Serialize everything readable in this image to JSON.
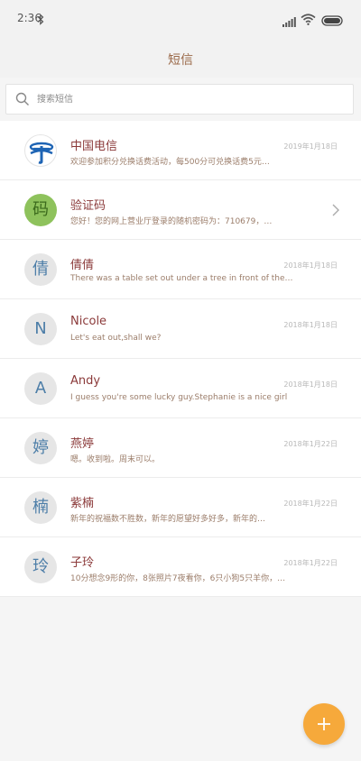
{
  "status_bar": {
    "time": "2:36",
    "icons": [
      "bluetooth-icon",
      "signal-icon",
      "wifi-icon",
      "battery-icon"
    ]
  },
  "header": {
    "title": "短信"
  },
  "search": {
    "placeholder": "搜索短信"
  },
  "conversations": [
    {
      "avatar_icon": "china-telecom-logo-icon",
      "avatar_text": "",
      "sender": "中国电信",
      "date": "2019年1月18日",
      "preview": "欢迎参加积分兑换话费活动，每500分可兑换话费5元…"
    },
    {
      "avatar_icon": "",
      "avatar_text": "码",
      "sender": "验证码",
      "date": "",
      "preview": "您好！您的网上营业厅登录的随机密码为：710679，…"
    },
    {
      "avatar_icon": "",
      "avatar_text": "倩",
      "sender": "倩倩",
      "date": "2018年1月18日",
      "preview": "There was a table set out under a tree in front of the…"
    },
    {
      "avatar_icon": "",
      "avatar_text": "N",
      "sender": "Nicole",
      "date": "2018年1月18日",
      "preview": "Let's eat out,shall we?"
    },
    {
      "avatar_icon": "",
      "avatar_text": "A",
      "sender": "Andy",
      "date": "2018年1月18日",
      "preview": "I guess you're some lucky guy.Stephanie is a nice girl"
    },
    {
      "avatar_icon": "",
      "avatar_text": "婷",
      "sender": "燕婷",
      "date": "2018年1月22日",
      "preview": "嗯。收到啦。周末可以。"
    },
    {
      "avatar_icon": "",
      "avatar_text": "楠",
      "sender": "紫楠",
      "date": "2018年1月22日",
      "preview": "新年的祝福数不胜数，新年的愿望好多好多，新年的…"
    },
    {
      "avatar_icon": "",
      "avatar_text": "玲",
      "sender": "子玲",
      "date": "2018年1月22日",
      "preview": "10分想念9形的你，8张照片7夜看你，6只小狗5只羊你，…"
    }
  ],
  "fab": {
    "icon": "plus-icon",
    "color": "#f6a93b"
  },
  "colors": {
    "sender_name": "#8b3a3a",
    "accent_orange": "#f6a93b",
    "avatar_green": "#8ec25c"
  }
}
